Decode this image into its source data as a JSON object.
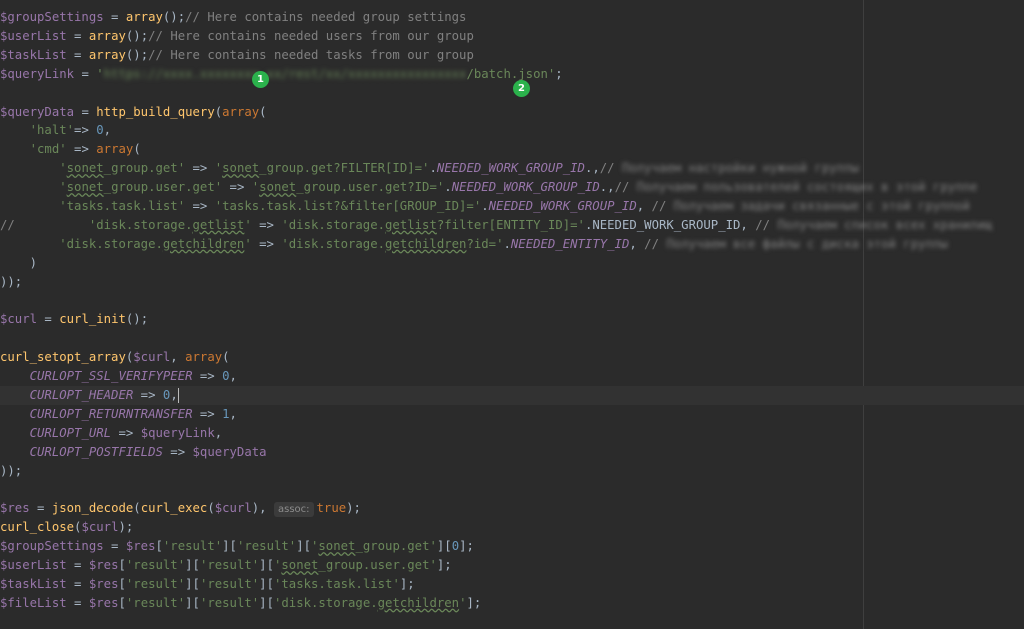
{
  "markers": [
    "1",
    "2"
  ],
  "inlay_hint": "assoc:",
  "code_lines": [
    [
      [
        "var",
        "$groupSettings"
      ],
      [
        "plain",
        " = "
      ],
      [
        "fn",
        "array"
      ],
      [
        "plain",
        "();"
      ],
      [
        "com",
        "// Here contains needed group settings"
      ]
    ],
    [
      [
        "var",
        "$userList"
      ],
      [
        "plain",
        " = "
      ],
      [
        "fn",
        "array"
      ],
      [
        "plain",
        "();"
      ],
      [
        "com",
        "// Here contains needed users from our group"
      ]
    ],
    [
      [
        "var",
        "$taskList"
      ],
      [
        "plain",
        " = "
      ],
      [
        "fn",
        "array"
      ],
      [
        "plain",
        "();"
      ],
      [
        "com",
        "// Here contains needed tasks from our group"
      ]
    ],
    [
      [
        "var",
        "$queryLink"
      ],
      [
        "plain",
        " = "
      ],
      [
        "str",
        "'"
      ],
      [
        "strblur",
        "https://xxxx.xxxxxxxx.xx/rest/xx/xxxxxxxxxxxxxxxx"
      ],
      [
        "str",
        "/batch.json'"
      ],
      [
        "plain",
        ";"
      ]
    ],
    [],
    [
      [
        "var",
        "$queryData"
      ],
      [
        "plain",
        " = "
      ],
      [
        "fn",
        "http_build_query"
      ],
      [
        "plain",
        "("
      ],
      [
        "kw",
        "array"
      ],
      [
        "plain",
        "("
      ]
    ],
    [
      [
        "plain",
        "    "
      ],
      [
        "str",
        "'halt'"
      ],
      [
        "plain",
        "=> "
      ],
      [
        "num",
        "0"
      ],
      [
        "plain",
        ","
      ]
    ],
    [
      [
        "plain",
        "    "
      ],
      [
        "str",
        "'cmd'"
      ],
      [
        "plain",
        " => "
      ],
      [
        "kw",
        "array"
      ],
      [
        "plain",
        "("
      ]
    ],
    [
      [
        "plain",
        "        "
      ],
      [
        "str",
        "'"
      ],
      [
        "strul",
        "sonet"
      ],
      [
        "str",
        "_group.get'"
      ],
      [
        "plain",
        " => "
      ],
      [
        "str",
        "'"
      ],
      [
        "strul",
        "sonet"
      ],
      [
        "str",
        "_group.get?FILTER[ID]='"
      ],
      [
        "plain",
        "."
      ],
      [
        "const",
        "NEEDED_WORK_GROUP_ID"
      ],
      [
        "plain",
        ".,"
      ],
      [
        "com",
        "// "
      ],
      [
        "blur",
        "Получаем настройки нужной группы"
      ]
    ],
    [
      [
        "plain",
        "        "
      ],
      [
        "str",
        "'"
      ],
      [
        "strul",
        "sonet"
      ],
      [
        "str",
        "_group.user.get'"
      ],
      [
        "plain",
        " => "
      ],
      [
        "str",
        "'"
      ],
      [
        "strul",
        "sonet"
      ],
      [
        "str",
        "_group.user.get?ID='"
      ],
      [
        "plain",
        "."
      ],
      [
        "const",
        "NEEDED_WORK_GROUP_ID"
      ],
      [
        "plain",
        ".,"
      ],
      [
        "com",
        "// "
      ],
      [
        "blur",
        "Получаем пользователей состоящих в этой группе"
      ]
    ],
    [
      [
        "plain",
        "        "
      ],
      [
        "str",
        "'tasks.task.list'"
      ],
      [
        "plain",
        " => "
      ],
      [
        "str",
        "'tasks.task.list?&filter[GROUP_ID]='"
      ],
      [
        "plain",
        "."
      ],
      [
        "const",
        "NEEDED_WORK_GROUP_ID"
      ],
      [
        "plain",
        ", "
      ],
      [
        "com",
        "// "
      ],
      [
        "blur",
        "Получаем задачи связанные с этой группой"
      ]
    ],
    [
      [
        "com",
        "//"
      ],
      [
        "plain",
        "          "
      ],
      [
        "str",
        "'disk.storage."
      ],
      [
        "strul",
        "getlist"
      ],
      [
        "str",
        "'"
      ],
      [
        "plain",
        " => "
      ],
      [
        "str",
        "'disk.storage."
      ],
      [
        "strul",
        "getlist"
      ],
      [
        "str",
        "?filter[ENTITY_ID]='"
      ],
      [
        "plain",
        ".NEEDED_WORK_GROUP_ID, "
      ],
      [
        "com",
        "// "
      ],
      [
        "blur",
        "Получаем список всех хранилищ"
      ]
    ],
    [
      [
        "plain",
        "        "
      ],
      [
        "str",
        "'disk.storage."
      ],
      [
        "strul",
        "getchildren"
      ],
      [
        "str",
        "'"
      ],
      [
        "plain",
        " => "
      ],
      [
        "str",
        "'disk.storage."
      ],
      [
        "strul",
        "getchildren"
      ],
      [
        "str",
        "?id='"
      ],
      [
        "plain",
        "."
      ],
      [
        "const",
        "NEEDED_ENTITY_ID"
      ],
      [
        "plain",
        ", "
      ],
      [
        "com",
        "// "
      ],
      [
        "blur",
        "Получаем все файлы с диска этой группы"
      ]
    ],
    [
      [
        "plain",
        "    )"
      ]
    ],
    [
      [
        "plain",
        "));"
      ]
    ],
    [],
    [
      [
        "var",
        "$curl"
      ],
      [
        "plain",
        " = "
      ],
      [
        "fn",
        "curl_init"
      ],
      [
        "plain",
        "();"
      ]
    ],
    [],
    [
      [
        "fn",
        "curl_setopt_array"
      ],
      [
        "plain",
        "("
      ],
      [
        "var",
        "$curl"
      ],
      [
        "plain",
        ", "
      ],
      [
        "kw",
        "array"
      ],
      [
        "plain",
        "("
      ]
    ],
    [
      [
        "plain",
        "    "
      ],
      [
        "const",
        "CURLOPT_SSL_VERIFYPEER"
      ],
      [
        "plain",
        " => "
      ],
      [
        "num",
        "0"
      ],
      [
        "plain",
        ","
      ]
    ],
    [
      [
        "plain",
        "    "
      ],
      [
        "const",
        "CURLOPT_HEADER"
      ],
      [
        "plain",
        " => "
      ],
      [
        "num",
        "0"
      ],
      [
        "plain",
        ","
      ],
      [
        "caret",
        ""
      ]
    ],
    [
      [
        "plain",
        "    "
      ],
      [
        "const",
        "CURLOPT_RETURNTRANSFER"
      ],
      [
        "plain",
        " => "
      ],
      [
        "num",
        "1"
      ],
      [
        "plain",
        ","
      ]
    ],
    [
      [
        "plain",
        "    "
      ],
      [
        "const",
        "CURLOPT_URL"
      ],
      [
        "plain",
        " => "
      ],
      [
        "var",
        "$queryLink"
      ],
      [
        "plain",
        ","
      ]
    ],
    [
      [
        "plain",
        "    "
      ],
      [
        "const",
        "CURLOPT_POSTFIELDS"
      ],
      [
        "plain",
        " => "
      ],
      [
        "var",
        "$queryData"
      ]
    ],
    [
      [
        "plain",
        "));"
      ]
    ],
    [],
    [
      [
        "var",
        "$res"
      ],
      [
        "plain",
        " = "
      ],
      [
        "fn",
        "json_decode"
      ],
      [
        "plain",
        "("
      ],
      [
        "fn",
        "curl_exec"
      ],
      [
        "plain",
        "("
      ],
      [
        "var",
        "$curl"
      ],
      [
        "plain",
        "), "
      ],
      [
        "hint",
        ""
      ],
      [
        "kw",
        "true"
      ],
      [
        "plain",
        ");"
      ]
    ],
    [
      [
        "fn",
        "curl_close"
      ],
      [
        "plain",
        "("
      ],
      [
        "var",
        "$curl"
      ],
      [
        "plain",
        ");"
      ]
    ],
    [
      [
        "var",
        "$groupSettings"
      ],
      [
        "plain",
        " = "
      ],
      [
        "var",
        "$res"
      ],
      [
        "plain",
        "["
      ],
      [
        "str",
        "'result'"
      ],
      [
        "plain",
        "]["
      ],
      [
        "str",
        "'result'"
      ],
      [
        "plain",
        "]["
      ],
      [
        "str",
        "'"
      ],
      [
        "strul",
        "sonet"
      ],
      [
        "str",
        "_group.get'"
      ],
      [
        "plain",
        "]["
      ],
      [
        "num",
        "0"
      ],
      [
        "plain",
        "];"
      ]
    ],
    [
      [
        "var",
        "$userList"
      ],
      [
        "plain",
        " = "
      ],
      [
        "var",
        "$res"
      ],
      [
        "plain",
        "["
      ],
      [
        "str",
        "'result'"
      ],
      [
        "plain",
        "]["
      ],
      [
        "str",
        "'result'"
      ],
      [
        "plain",
        "]["
      ],
      [
        "str",
        "'"
      ],
      [
        "strul",
        "sonet"
      ],
      [
        "str",
        "_group.user.get'"
      ],
      [
        "plain",
        "];"
      ]
    ],
    [
      [
        "var",
        "$taskList"
      ],
      [
        "plain",
        " = "
      ],
      [
        "var",
        "$res"
      ],
      [
        "plain",
        "["
      ],
      [
        "str",
        "'result'"
      ],
      [
        "plain",
        "]["
      ],
      [
        "str",
        "'result'"
      ],
      [
        "plain",
        "]["
      ],
      [
        "str",
        "'tasks.task.list'"
      ],
      [
        "plain",
        "];"
      ]
    ],
    [
      [
        "var",
        "$fileList"
      ],
      [
        "plain",
        " = "
      ],
      [
        "var",
        "$res"
      ],
      [
        "plain",
        "["
      ],
      [
        "str",
        "'result'"
      ],
      [
        "plain",
        "]["
      ],
      [
        "str",
        "'result'"
      ],
      [
        "plain",
        "]["
      ],
      [
        "str",
        "'disk.storage."
      ],
      [
        "strul",
        "getchildren"
      ],
      [
        "str",
        "'"
      ],
      [
        "plain",
        "];"
      ]
    ]
  ]
}
